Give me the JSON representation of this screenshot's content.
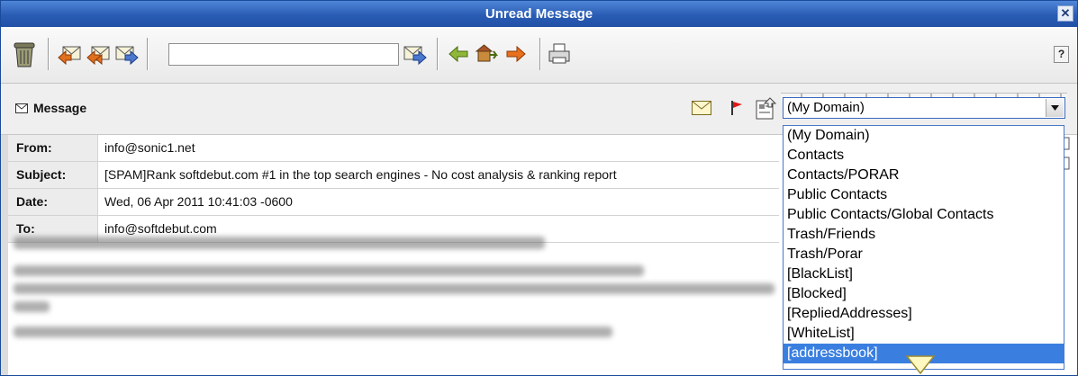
{
  "window": {
    "title": "Unread Message",
    "close_icon": "close-icon"
  },
  "toolbar": {
    "search_value": "",
    "buttons": [
      "trash-icon",
      "reply-icon",
      "reply-all-icon",
      "forward-icon",
      "go-icon",
      "back-arrow-icon",
      "home-icon",
      "forward-arrow-icon",
      "print-icon"
    ],
    "help_label": "?"
  },
  "message_header": {
    "label": "Message",
    "folder_select_value": "(My Domain)"
  },
  "fields": [
    {
      "key": "From:",
      "value": "info@sonic1.net"
    },
    {
      "key": "Subject:",
      "value": "[SPAM]Rank softdebut.com #1 in the top search engines - No cost analysis & ranking report"
    },
    {
      "key": "Date:",
      "value": "Wed, 06 Apr 2011 10:41:03 -0600"
    },
    {
      "key": "To:",
      "value": "info@softdebut.com"
    }
  ],
  "dropdown": {
    "options": [
      "(My Domain)",
      "Contacts",
      "Contacts/PORAR",
      "Public Contacts",
      "Public Contacts/Global Contacts",
      "Trash/Friends",
      "Trash/Porar",
      "[BlackList]",
      "[Blocked]",
      "[RepliedAddresses]",
      "[WhiteList]",
      "[addressbook]"
    ],
    "highlighted": "[addressbook]"
  },
  "colors": {
    "title_bar": "#2a5cb4",
    "highlight": "#3a7fe0"
  }
}
